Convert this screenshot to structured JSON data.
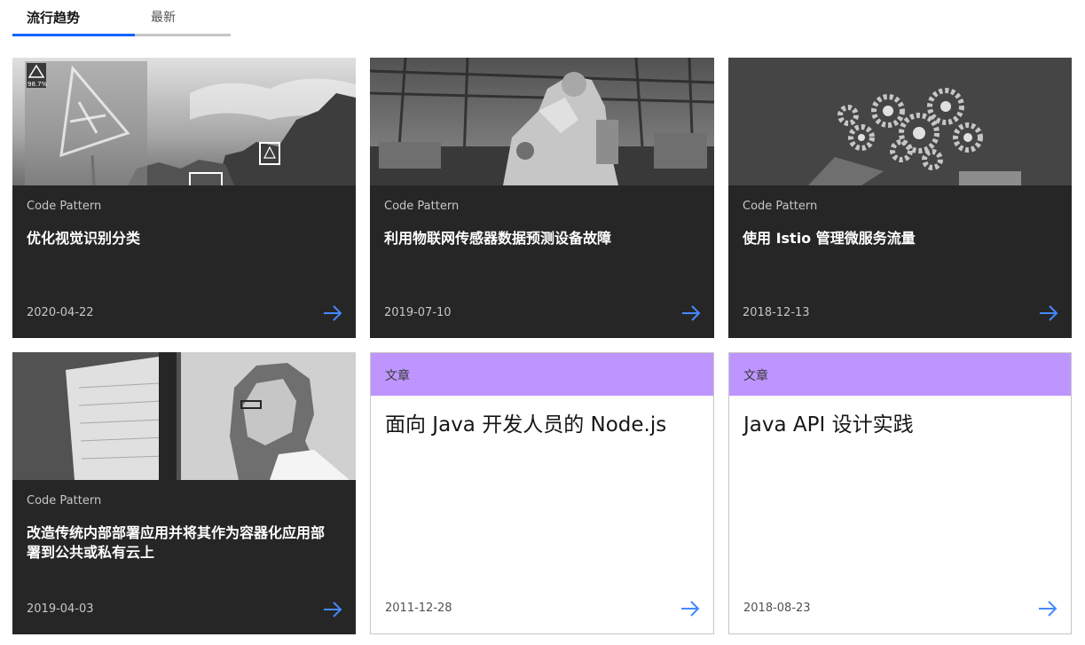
{
  "tabs": [
    {
      "label": "流行趋势",
      "active": true
    },
    {
      "label": "最新",
      "active": false
    }
  ],
  "cards": [
    {
      "type": "Code Pattern",
      "title": "优化视觉识别分类",
      "date": "2020-04-22",
      "image": "road-sign-detection-photo",
      "overlay_text": "98.7%"
    },
    {
      "type": "Code Pattern",
      "title": "利用物联网传感器数据预测设备故障",
      "date": "2019-07-10",
      "image": "industrial-robot-arm-photo"
    },
    {
      "type": "Code Pattern",
      "title": "使用 Istio 管理微服务流量",
      "date": "2018-12-13",
      "image": "gears-chalkboard-photo"
    },
    {
      "type": "Code Pattern",
      "title": "改造传统内部部署应用并将其作为容器化应用部署到公共或私有云上",
      "date": "2019-04-03",
      "image": "woman-at-monitor-photo"
    },
    {
      "type": "文章",
      "title": "面向 Java 开发人员的 Node.js",
      "date": "2011-12-28"
    },
    {
      "type": "文章",
      "title": "Java API 设计实践",
      "date": "2018-08-23"
    }
  ],
  "colors": {
    "accent": "#0f62fe",
    "card_dark": "#262626",
    "article_label": "#be95ff",
    "arrow": "#4589ff"
  },
  "icons": {
    "card_link": "arrow-right-icon"
  }
}
